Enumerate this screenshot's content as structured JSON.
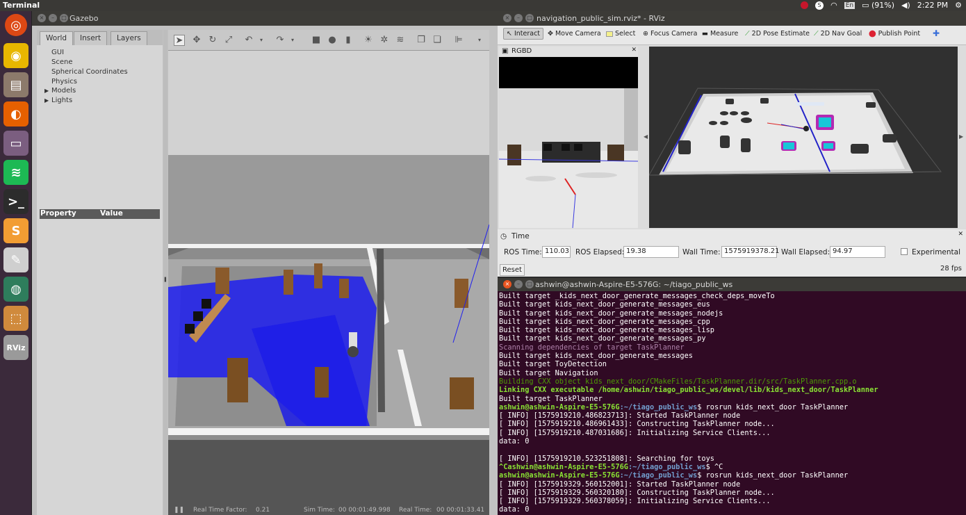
{
  "topbar": {
    "app_name": "Terminal",
    "battery": "(91%)",
    "lang": "En",
    "clock": "2:22 PM"
  },
  "launcher": {
    "items": [
      {
        "name": "ubuntu-icon",
        "glyph": "◎",
        "color": "#dd4814"
      },
      {
        "name": "chrome-icon",
        "glyph": "◉",
        "color": "#e8b700"
      },
      {
        "name": "files-icon",
        "glyph": "▤",
        "color": "#8c7a6b"
      },
      {
        "name": "firefox-icon",
        "glyph": "◐",
        "color": "#e66000"
      },
      {
        "name": "drawer-icon",
        "glyph": "▭",
        "color": "#7b5e80"
      },
      {
        "name": "spotify-icon",
        "glyph": "≋",
        "color": "#1db954"
      },
      {
        "name": "terminal-icon",
        "glyph": ">_",
        "color": "#2c2c2c"
      },
      {
        "name": "sublime-icon",
        "glyph": "S",
        "color": "#f29d33"
      },
      {
        "name": "editor-icon",
        "glyph": "✎",
        "color": "#cfcfcf"
      },
      {
        "name": "globe-icon",
        "glyph": "◍",
        "color": "#2e7d5c"
      },
      {
        "name": "box-icon",
        "glyph": "⬚",
        "color": "#d08a3c"
      },
      {
        "name": "rviz-icon",
        "glyph": "RViz",
        "color": "#9a9a9a"
      }
    ]
  },
  "gazebo": {
    "title": "Gazebo",
    "tabs": [
      "World",
      "Insert",
      "Layers"
    ],
    "tree": [
      "GUI",
      "Scene",
      "Spherical Coordinates",
      "Physics",
      "Models",
      "Lights"
    ],
    "property_header": {
      "property": "Property",
      "value": "Value"
    },
    "status": {
      "real_time_factor_label": "Real Time Factor:",
      "real_time_factor": "0.21",
      "sim_time_label": "Sim Time:",
      "sim_time": "00 00:01:49.998",
      "real_time_label": "Real Time:",
      "real_time": "00 00:01:33.41"
    }
  },
  "rviz": {
    "title": "navigation_public_sim.rviz* - RViz",
    "tools": [
      "Interact",
      "Move Camera",
      "Select",
      "Focus Camera",
      "Measure",
      "2D Pose Estimate",
      "2D Nav Goal",
      "Publish Point"
    ],
    "rgbd_panel": "RGBD",
    "time_panel": {
      "title": "Time",
      "ros_time_label": "ROS Time:",
      "ros_time": "110.03",
      "ros_elapsed_label": "ROS Elapsed:",
      "ros_elapsed": "19.38",
      "wall_time_label": "Wall Time:",
      "wall_time": "1575919378.21",
      "wall_elapsed_label": "Wall Elapsed:",
      "wall_elapsed": "94.97",
      "experimental_label": "Experimental",
      "reset_label": "Reset",
      "fps": "28 fps"
    }
  },
  "terminal": {
    "title": "ashwin@ashwin-Aspire-E5-576G: ~/tiago_public_ws",
    "lines": [
      {
        "text": "Built target _kids_next_door_generate_messages_check_deps_moveTo",
        "style": ""
      },
      {
        "text": "Built target kids_next_door_generate_messages_eus",
        "style": ""
      },
      {
        "text": "Built target kids_next_door_generate_messages_nodejs",
        "style": ""
      },
      {
        "text": "Built target kids_next_door_generate_messages_cpp",
        "style": ""
      },
      {
        "text": "Built target kids_next_door_generate_messages_lisp",
        "style": ""
      },
      {
        "text": "Built target kids_next_door_generate_messages_py",
        "style": ""
      },
      {
        "text": "Scanning dependencies of target TaskPlanner",
        "style": "mag"
      },
      {
        "text": "Built target kids_next_door_generate_messages",
        "style": ""
      },
      {
        "text": "Built target ToyDetection",
        "style": ""
      },
      {
        "text": "Built target Navigation",
        "style": ""
      },
      {
        "text": "Building CXX object kids_next_door/CMakeFiles/TaskPlanner.dir/src/TaskPlanner.cpp.o",
        "style": "dgreen"
      },
      {
        "text": "Linking CXX executable /home/ashwin/tiago_public_ws/devel/lib/kids_next_door/TaskPlanner",
        "style": "green"
      },
      {
        "text": "Built target TaskPlanner",
        "style": ""
      },
      {
        "prompt_user": "ashwin@ashwin-Aspire-E5-576G",
        "prompt_path": ":~/tiago_public_ws",
        "cmd": "$ rosrun kids_next_door TaskPlanner",
        "style": "prompt"
      },
      {
        "text": "[ INFO] [1575919210.486823713]: Started TaskPlanner node",
        "style": ""
      },
      {
        "text": "[ INFO] [1575919210.486961433]: Constructing TaskPlanner node...",
        "style": ""
      },
      {
        "text": "[ INFO] [1575919210.487031686]: Initializing Service Clients...",
        "style": ""
      },
      {
        "text": "data: 0",
        "style": ""
      },
      {
        "text": " ",
        "style": ""
      },
      {
        "text": "[ INFO] [1575919210.523251808]: Searching for toys",
        "style": ""
      },
      {
        "prompt_user": "^Cashwin@ashwin-Aspire-E5-576G",
        "prompt_path": ":~/tiago_public_ws",
        "cmd": "$ ^C",
        "style": "prompt"
      },
      {
        "prompt_user": "ashwin@ashwin-Aspire-E5-576G",
        "prompt_path": ":~/tiago_public_ws",
        "cmd": "$ rosrun kids_next_door TaskPlanner",
        "style": "prompt"
      },
      {
        "text": "[ INFO] [1575919329.560152001]: Started TaskPlanner node",
        "style": ""
      },
      {
        "text": "[ INFO] [1575919329.560320180]: Constructing TaskPlanner node...",
        "style": ""
      },
      {
        "text": "[ INFO] [1575919329.560378059]: Initializing Service Clients...",
        "style": ""
      },
      {
        "text": "data: 0",
        "style": ""
      }
    ]
  }
}
